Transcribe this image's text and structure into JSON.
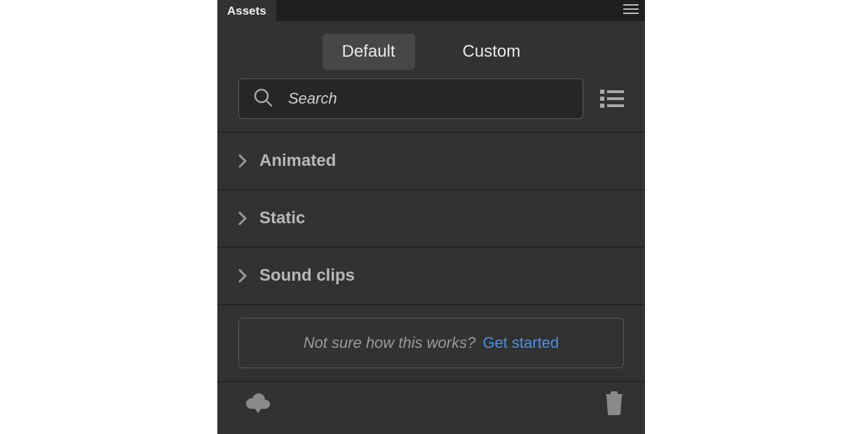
{
  "panel": {
    "title": "Assets"
  },
  "tabs": {
    "default": "Default",
    "custom": "Custom"
  },
  "search": {
    "placeholder": "Search"
  },
  "categories": [
    {
      "label": "Animated"
    },
    {
      "label": "Static"
    },
    {
      "label": "Sound clips"
    }
  ],
  "help": {
    "prompt": "Not sure how this works?",
    "link": "Get started"
  }
}
